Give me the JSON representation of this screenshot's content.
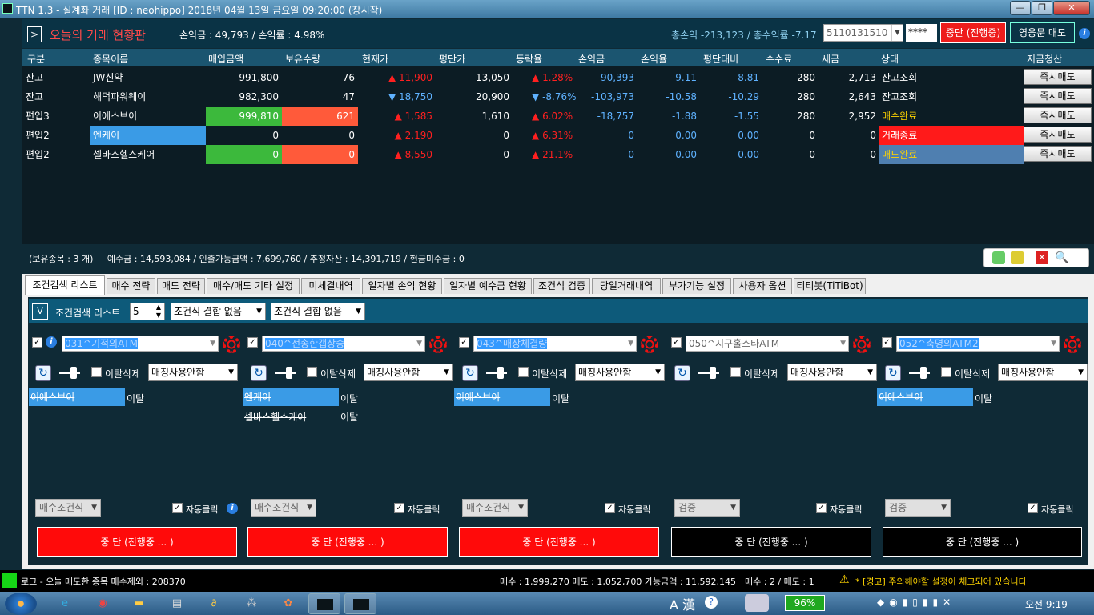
{
  "window": {
    "title": "TTN 1.3 - 실계좌 거래 [ID : neohippo] 2018년 04월 13일 금요일 09:20:00 (장시작)",
    "minimize": "—",
    "maximize": "❐",
    "close": "✕"
  },
  "header": {
    "toggle": ">",
    "title": "오늘의 거래 현황판",
    "stats": "손익금 : 49,793  /  손익률 : 4.98%",
    "totals": "총손익 -213,123 / 총수익률 -7.17",
    "account": "5110131510",
    "password": "****",
    "stop_button": "중단 (진행중)",
    "sell_button": "영웅문 매도",
    "info": "i"
  },
  "table": {
    "columns": [
      "구분",
      "종목이름",
      "매입금액",
      "보유수량",
      "현재가",
      "평단가",
      "등락율",
      "손익금",
      "손익율",
      "평단대비",
      "수수료",
      "세금",
      "상태",
      "지금청산"
    ],
    "rows": [
      {
        "type": "잔고",
        "name": "JW신약",
        "buy_amount": "991,800",
        "qty": "76",
        "price_arrow": "▲",
        "price": "11,900",
        "price_dir": "up",
        "avg": "13,050",
        "rate_arrow": "▲",
        "rate": "1.28%",
        "rate_dir": "up",
        "pl": "-90,393",
        "pl_rate": "-9.11",
        "vs_avg": "-8.81",
        "fee": "280",
        "tax": "2,713",
        "status": "잔고조회",
        "action": "즉시매도"
      },
      {
        "type": "잔고",
        "name": "해덕파워웨이",
        "buy_amount": "982,300",
        "qty": "47",
        "price_arrow": "▼",
        "price": "18,750",
        "price_dir": "dn",
        "avg": "20,900",
        "rate_arrow": "▼",
        "rate": "-8.76%",
        "rate_dir": "dn",
        "pl": "-103,973",
        "pl_rate": "-10.58",
        "vs_avg": "-10.29",
        "fee": "280",
        "tax": "2,643",
        "status": "잔고조회",
        "action": "즉시매도"
      },
      {
        "type": "편입3",
        "name": "이에스브이",
        "buy_amount": "999,810",
        "qty": "621",
        "price_arrow": "▲",
        "price": "1,585",
        "price_dir": "up",
        "avg": "1,610",
        "rate_arrow": "▲",
        "rate": "6.02%",
        "rate_dir": "up",
        "pl": "-18,757",
        "pl_rate": "-1.88",
        "vs_avg": "-1.55",
        "fee": "280",
        "tax": "2,952",
        "status": "매수완료",
        "action": "즉시매도"
      },
      {
        "type": "편입2",
        "name": "엔케이",
        "buy_amount": "0",
        "qty": "0",
        "price_arrow": "▲",
        "price": "2,190",
        "price_dir": "up",
        "avg": "0",
        "rate_arrow": "▲",
        "rate": "6.31%",
        "rate_dir": "up",
        "pl": "0",
        "pl_rate": "0.00",
        "vs_avg": "0.00",
        "fee": "0",
        "tax": "0",
        "status": "거래종료",
        "action": "즉시매도"
      },
      {
        "type": "편입2",
        "name": "셀바스헬스케어",
        "buy_amount": "0",
        "qty": "0",
        "price_arrow": "▲",
        "price": "8,550",
        "price_dir": "up",
        "avg": "0",
        "rate_arrow": "▲",
        "rate": "21.1%",
        "rate_dir": "up",
        "pl": "0",
        "pl_rate": "0.00",
        "vs_avg": "0.00",
        "fee": "0",
        "tax": "0",
        "status": "매도완료",
        "action": "즉시매도"
      }
    ]
  },
  "summary": {
    "holdings": "(보유종목 : 3 개)",
    "balance": "예수금 : 14,593,084 / 인출가능금액 : 7,699,760 / 추정자산 : 14,391,719 / 현금미수금 : 0"
  },
  "tabs": [
    "조건검색 리스트",
    "매수 전략",
    "매도 전략",
    "매수/매도 기타 설정",
    "미체결내역",
    "일자별 손익 현황",
    "일자별 예수금 현황",
    "조건식 검증",
    "당일거래내역",
    "부가기능 설정",
    "사용자 옵션",
    "티티봇(TiTiBot)"
  ],
  "cond_panel": {
    "toggle": "V",
    "list_label": "조건검색 리스트",
    "count": "5",
    "combine1": "조건식 결합 없음",
    "combine2": "조건식 결합 없음",
    "slots": [
      {
        "cond": "031^기적의ATM",
        "match": "매칭사용안함",
        "exit_label": "이탈삭제",
        "stocks": [
          "이에스브이"
        ],
        "status": [
          "이탈"
        ],
        "buy_cond": "매수조건식",
        "auto_click": "자동클릭",
        "stop": "중 단 (진행중 ... )"
      },
      {
        "cond": "040^전송한갭상승",
        "match": "매칭사용안함",
        "exit_label": "이탈삭제",
        "stocks": [
          "엔케이",
          "셀바스헬스케어"
        ],
        "status": [
          "이탈",
          "이탈"
        ],
        "buy_cond": "매수조건식",
        "auto_click": "자동클릭",
        "stop": "중 단 (진행중 ... )"
      },
      {
        "cond": "043^매상체결량",
        "match": "매칭사용안함",
        "exit_label": "이탈삭제",
        "stocks": [
          "이에스브이"
        ],
        "status": [
          "이탈"
        ],
        "buy_cond": "매수조건식",
        "auto_click": "자동클릭",
        "stop": "중 단 (진행중 ... )"
      },
      {
        "cond": "050^지구홀스타ATM",
        "match": "매칭사용안함",
        "exit_label": "이탈삭제",
        "stocks": [],
        "status": [],
        "buy_cond": "검증",
        "auto_click": "자동클릭",
        "stop": "중 단 (진행중 ... )"
      },
      {
        "cond": "052^축명의ATM2",
        "match": "매칭사용안함",
        "exit_label": "이탈삭제",
        "stocks": [
          "이에스브이"
        ],
        "status": [
          "이탈"
        ],
        "buy_cond": "검증",
        "auto_click": "자동클릭",
        "stop": "중 단 (진행중 ... )"
      }
    ]
  },
  "statusbar": {
    "log": "로그 - 오늘 매도한 종목 매수제외 : 208370",
    "trade": "매수 : 1,999,270 매도 : 1,052,700 가능금액 : 11,592,145",
    "count": "매수 : 2 / 매도 : 1",
    "warning": "* [경고] 주의해야할 설정이 체크되어 있습니다"
  },
  "taskbar": {
    "battery": "96%",
    "clock": "오전 9:19",
    "ime": "A 漢"
  },
  "colors": {
    "accent_red": "#ee1c1c",
    "up": "#ff2020",
    "down": "#5fb2ff",
    "green": "#3cb93c",
    "orange": "#ff5a3a",
    "blue": "#3a9be6"
  }
}
